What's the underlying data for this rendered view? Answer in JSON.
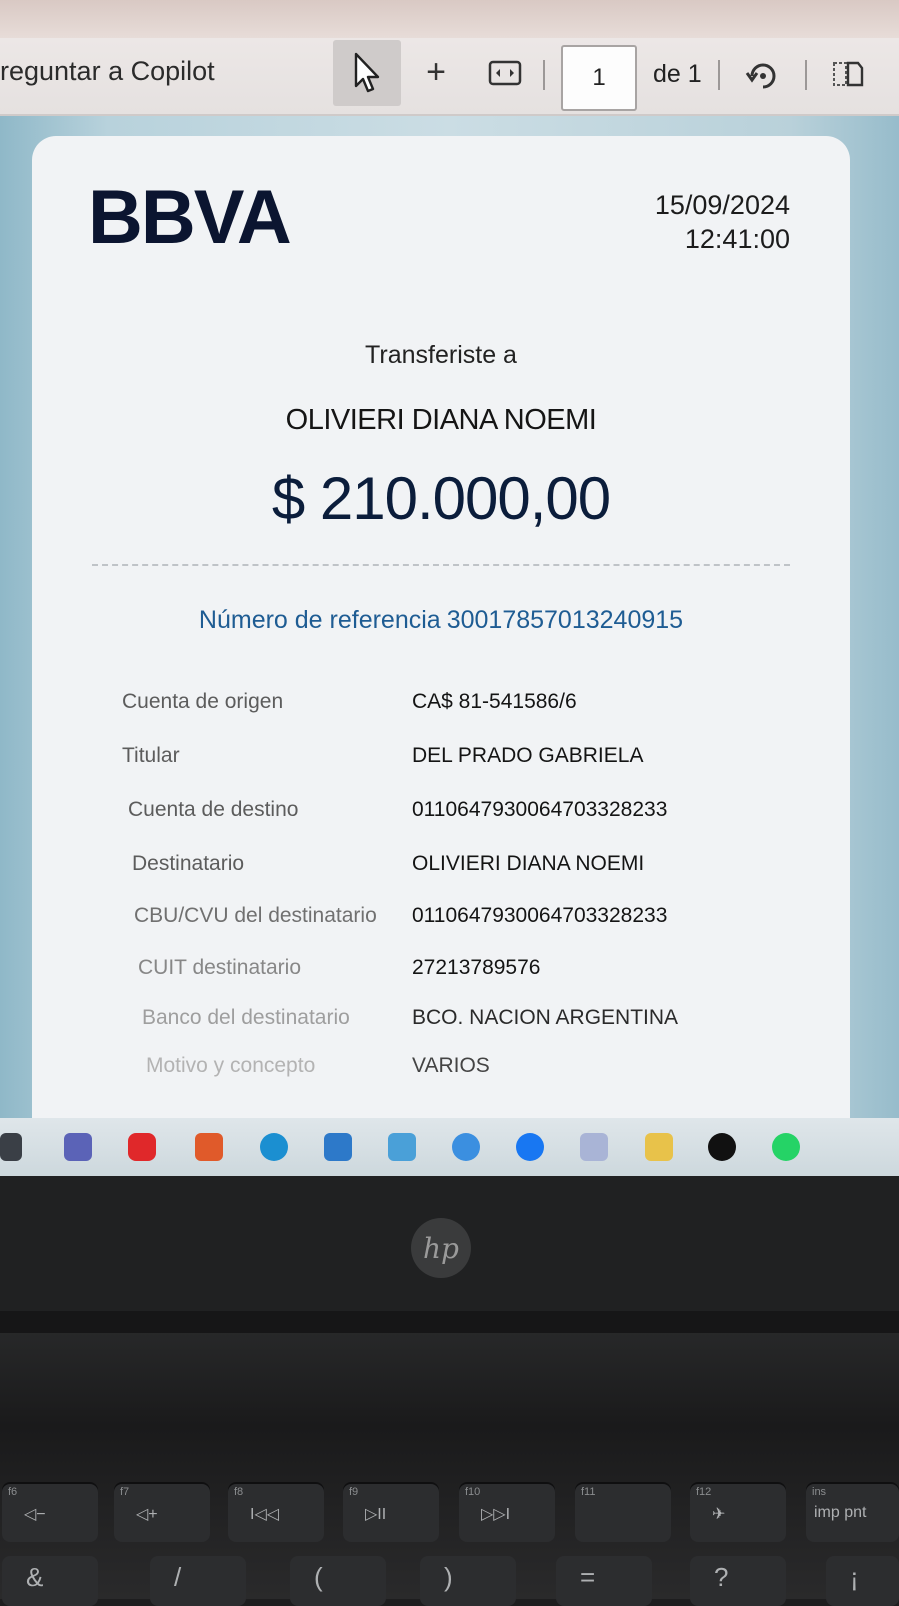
{
  "toolbar": {
    "copilot_label": "reguntar a Copilot",
    "page_current": "1",
    "page_total_label": "de 1"
  },
  "document": {
    "logo_text": "BBVA",
    "date": "15/09/2024",
    "time": "12:41:00",
    "heading": "Transferiste a",
    "recipient_name": "OLIVIERI DIANA NOEMI",
    "amount": "$ 210.000,00",
    "reference_label": "Número de referencia",
    "reference_number": "30017857013240915",
    "details": [
      {
        "label": "Cuenta de origen",
        "value": "CA$ 81-541586/6"
      },
      {
        "label": "Titular",
        "value": "DEL PRADO GABRIELA"
      },
      {
        "label": "Cuenta de destino",
        "value": "0110647930064703328233"
      },
      {
        "label": "Destinatario",
        "value": "OLIVIERI DIANA NOEMI"
      },
      {
        "label": "CBU/CVU del destinatario",
        "value": "0110647930064703328233"
      },
      {
        "label": "CUIT destinatario",
        "value": "27213789576"
      },
      {
        "label": "Banco del destinatario",
        "value": "BCO. NACION ARGENTINA"
      },
      {
        "label": "Motivo y concepto",
        "value": "VARIOS"
      }
    ]
  },
  "taskbar_icons": [
    "teams-icon",
    "youtube-icon",
    "office-icon",
    "edge-icon",
    "store-icon",
    "app-icon",
    "copilot-icon",
    "facebook-icon",
    "mail-icon",
    "folder-icon",
    "tiktok-icon",
    "whatsapp-icon"
  ],
  "brand": {
    "hp_logo": "hp"
  },
  "keyboard": {
    "fkeys": [
      {
        "fn": "f6",
        "sym": "◁−"
      },
      {
        "fn": "f7",
        "sym": "◁+"
      },
      {
        "fn": "f8",
        "sym": "I◁◁"
      },
      {
        "fn": "f9",
        "sym": "▷II"
      },
      {
        "fn": "f10",
        "sym": "▷▷I"
      },
      {
        "fn": "f11",
        "sym": ""
      },
      {
        "fn": "f12",
        "sym": "✈"
      },
      {
        "fn": "ins",
        "sym": "imp pnt"
      }
    ],
    "row2": [
      "&",
      "/",
      "(",
      ")",
      "=",
      "?",
      "¡"
    ]
  }
}
